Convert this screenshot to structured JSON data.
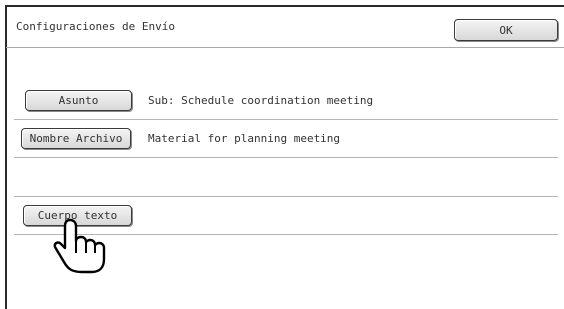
{
  "dialog": {
    "title": "Configuraciones de Envío",
    "ok_label": "OK"
  },
  "fields": [
    {
      "label": "Asunto",
      "value": "Sub: Schedule coordination meeting"
    },
    {
      "label": "Nombre Archivo",
      "value": "Material for planning meeting"
    },
    {
      "label": "Cuerpo texto",
      "value": ""
    }
  ],
  "icons": {
    "pointer": "pointing-hand-icon"
  }
}
